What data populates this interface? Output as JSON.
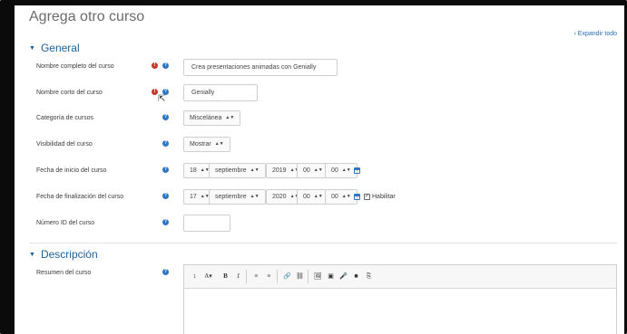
{
  "page": {
    "title": "Agrega otro curso",
    "expand_all": "Expandir todo"
  },
  "general": {
    "title": "General",
    "fields": {
      "fullname": {
        "label": "Nombre completo del curso",
        "value": "Crea presentaciones animadas con Genially"
      },
      "shortname": {
        "label": "Nombre corto del curso",
        "value": "Genially"
      },
      "category": {
        "label": "Categoría de cursos",
        "value": "Miscelánea"
      },
      "visibility": {
        "label": "Visibilidad del curso",
        "value": "Mostrar"
      },
      "startdate": {
        "label": "Fecha de inicio del curso",
        "day": "18",
        "month": "septiembre",
        "year": "2019",
        "hour": "00",
        "minute": "00"
      },
      "enddate": {
        "label": "Fecha de finalización del curso",
        "day": "17",
        "month": "septiembre",
        "year": "2020",
        "hour": "00",
        "minute": "00",
        "enable_label": "Habilitar"
      },
      "idnumber": {
        "label": "Número ID del curso",
        "value": ""
      }
    }
  },
  "description": {
    "title": "Descripción",
    "summary_label": "Resumen del curso",
    "toolbar": [
      "↕",
      "A▾",
      "B",
      "I",
      "≡",
      "≡",
      "🔗",
      "⛓",
      "🖼",
      "▣",
      "🎤",
      "■",
      "⎘"
    ]
  },
  "icons": {
    "required": "!",
    "help": "?"
  },
  "colors": {
    "accent": "#1b5f99",
    "required": "#c0392b",
    "help": "#2a77c9"
  }
}
